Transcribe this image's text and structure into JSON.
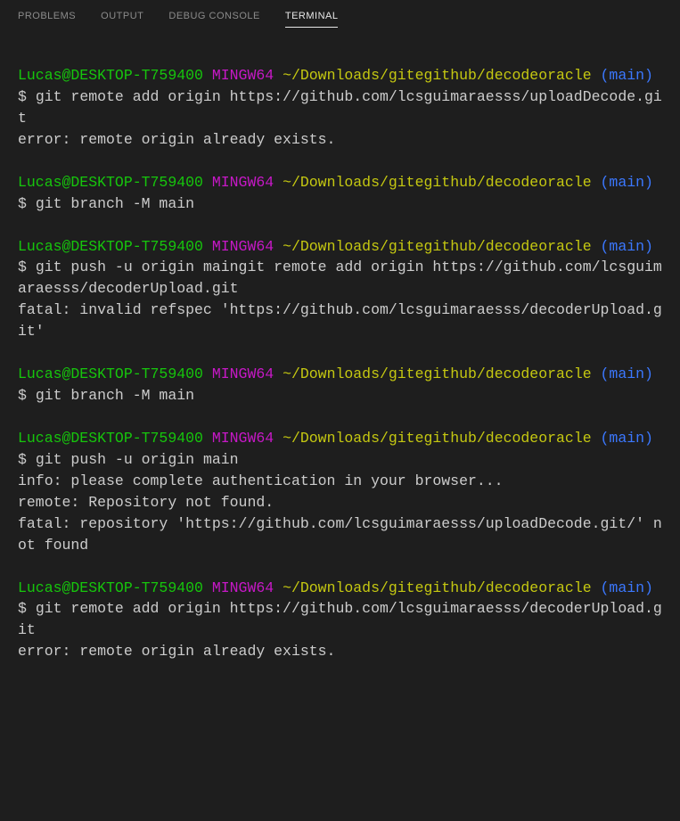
{
  "tabs": {
    "problems": "PROBLEMS",
    "output": "OUTPUT",
    "debug": "DEBUG CONSOLE",
    "terminal": "TERMINAL"
  },
  "prompt": {
    "user_host": "Lucas@DESKTOP-T759400",
    "mingw": "MINGW64",
    "path": "~/Downloads/gitegithub/decodeoracle",
    "branch": "(main)",
    "symbol": "$"
  },
  "blocks": [
    {
      "cmd": "git remote add origin https://github.com/lcsguimaraesss/uploadDecode.git",
      "output": [
        "error: remote origin already exists."
      ]
    },
    {
      "cmd": "git branch -M main",
      "output": []
    },
    {
      "cmd": "git push -u origin maingit remote add origin https://github.com/lcsguimaraesss/decoderUpload.git",
      "output": [
        "fatal: invalid refspec 'https://github.com/lcsguimaraesss/decoderUpload.git'"
      ]
    },
    {
      "cmd": "git branch -M main",
      "output": []
    },
    {
      "cmd": "git push -u origin main",
      "output": [
        "info: please complete authentication in your browser...",
        "remote: Repository not found.",
        "fatal: repository 'https://github.com/lcsguimaraesss/uploadDecode.git/' not found"
      ]
    },
    {
      "cmd": "git remote add origin https://github.com/lcsguimaraesss/decoderUpload.git",
      "output": [
        "error: remote origin already exists."
      ]
    }
  ]
}
